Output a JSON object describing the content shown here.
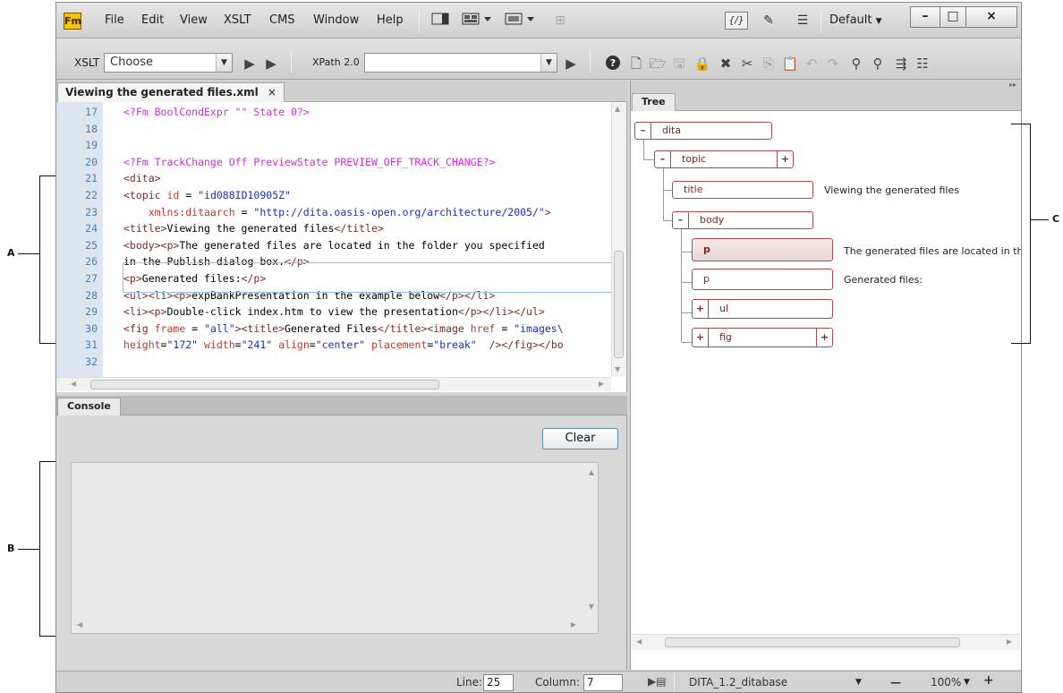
{
  "window": {
    "logo": "Fm",
    "menus": [
      "File",
      "Edit",
      "View",
      "XSLT",
      "CMS",
      "Window",
      "Help"
    ],
    "workspace": "Default",
    "controls": {
      "minimize": "–",
      "maximize": "□",
      "close": "×"
    }
  },
  "toolbar": {
    "xslt_label": "XSLT",
    "xslt_value": "Choose",
    "xpath_label": "XPath 2.0",
    "xpath_value": ""
  },
  "editor": {
    "tab_title": "Viewing the generated files.xml",
    "tab_close": "×",
    "lines": [
      {
        "n": "17",
        "segs": [
          [
            "pi",
            "<?Fm BoolCondExpr \"\" State 0?>"
          ]
        ]
      },
      {
        "n": "18",
        "segs": []
      },
      {
        "n": "19",
        "segs": []
      },
      {
        "n": "20",
        "segs": [
          [
            "pi",
            "<?Fm TrackChange Off PreviewState PREVIEW_OFF_TRACK_CHANGE?>"
          ]
        ]
      },
      {
        "n": "21",
        "segs": [
          [
            "tag",
            "<dita>"
          ]
        ]
      },
      {
        "n": "22",
        "segs": [
          [
            "tag",
            "<topic "
          ],
          [
            "attr",
            "id"
          ],
          [
            "txt",
            " = "
          ],
          [
            "val",
            "\"id088ID10905Z\""
          ]
        ]
      },
      {
        "n": "23",
        "segs": [
          [
            "attr",
            "    xmlns:ditaarch"
          ],
          [
            "txt",
            " = "
          ],
          [
            "val",
            "\"http://dita.oasis-open.org/architecture/2005/\""
          ],
          [
            "tag",
            ">"
          ]
        ]
      },
      {
        "n": "24",
        "segs": [
          [
            "tag",
            "<title>"
          ],
          [
            "txt",
            "Viewing the generated files"
          ],
          [
            "tag",
            "</title>"
          ]
        ]
      },
      {
        "n": "25",
        "segs": [
          [
            "tag",
            "<body>"
          ],
          [
            "tag",
            "<p>"
          ],
          [
            "txt",
            "The generated files are located in the folder you specified"
          ]
        ]
      },
      {
        "n": "26",
        "segs": [
          [
            "txt",
            "in the Publish dialog box."
          ],
          [
            "tag",
            "</p>"
          ]
        ]
      },
      {
        "n": "27",
        "segs": [
          [
            "tag",
            "<p>"
          ],
          [
            "txt",
            "Generated files:"
          ],
          [
            "tag",
            "</p>"
          ]
        ]
      },
      {
        "n": "28",
        "segs": [
          [
            "tag",
            "<ul><li><p>"
          ],
          [
            "txt",
            "expBankPresentation in the example below"
          ],
          [
            "tag",
            "</p></li>"
          ]
        ]
      },
      {
        "n": "29",
        "segs": [
          [
            "tag",
            "<li><p>"
          ],
          [
            "txt",
            "Double-click index.htm to view the presentation"
          ],
          [
            "tag",
            "</p></li></ul>"
          ]
        ]
      },
      {
        "n": "30",
        "segs": [
          [
            "tag",
            "<fig "
          ],
          [
            "attr",
            "frame"
          ],
          [
            "txt",
            " = "
          ],
          [
            "val",
            "\"all\""
          ],
          [
            "tag",
            "><title>"
          ],
          [
            "txt",
            "Generated Files"
          ],
          [
            "tag",
            "</title><image "
          ],
          [
            "attr",
            "href"
          ],
          [
            "txt",
            " = "
          ],
          [
            "val",
            "\"images\\"
          ]
        ]
      },
      {
        "n": "31",
        "segs": [
          [
            "attr",
            "height"
          ],
          [
            "txt",
            "="
          ],
          [
            "val",
            "\"172\" "
          ],
          [
            "attr",
            "width"
          ],
          [
            "txt",
            "="
          ],
          [
            "val",
            "\"241\" "
          ],
          [
            "attr",
            "align"
          ],
          [
            "txt",
            "="
          ],
          [
            "val",
            "\"center\" "
          ],
          [
            "attr",
            "placement"
          ],
          [
            "txt",
            "="
          ],
          [
            "val",
            "\"break\""
          ],
          [
            "tag",
            "  /></fig></bo"
          ]
        ]
      },
      {
        "n": "32",
        "segs": []
      }
    ]
  },
  "console": {
    "tab_title": "Console",
    "clear_label": "Clear"
  },
  "tree": {
    "tab_title": "Tree",
    "nodes": {
      "dita": {
        "toggle": "–",
        "label": "dita"
      },
      "topic": {
        "toggle": "–",
        "label": "topic",
        "expand": "+"
      },
      "title": {
        "label": "title",
        "text": "Viewing the generated files"
      },
      "body": {
        "toggle": "–",
        "label": "body"
      },
      "p1": {
        "label": "p",
        "text": "The generated files are located in the"
      },
      "p2": {
        "label": "p",
        "text": "Generated files:"
      },
      "ul": {
        "toggle": "+",
        "label": "ul"
      },
      "fig": {
        "toggle": "+",
        "label": "fig",
        "expand": "+"
      }
    }
  },
  "status": {
    "line_label": "Line:",
    "line_value": "25",
    "column_label": "Column:",
    "column_value": "7",
    "doctype": "DITA_1.2_ditabase",
    "zoom_minus": "—",
    "zoom": "100%",
    "zoom_plus": "+"
  },
  "callouts": {
    "a": "A",
    "b": "B",
    "c": "C"
  }
}
